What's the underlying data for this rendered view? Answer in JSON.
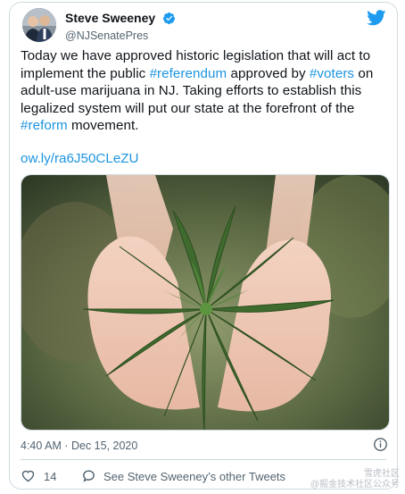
{
  "tweet": {
    "author": {
      "display_name": "Steve Sweeney",
      "handle": "@NJSenatePres",
      "verified": true
    },
    "text_parts": [
      {
        "type": "text",
        "value": "Today we have approved historic legislation that will act to implement the public "
      },
      {
        "type": "hashtag",
        "value": "#referendum"
      },
      {
        "type": "text",
        "value": " approved by "
      },
      {
        "type": "hashtag",
        "value": "#voters"
      },
      {
        "type": "text",
        "value": " on adult-use marijuana in NJ. Taking efforts to establish this legalized system will put our state at the forefront of the "
      },
      {
        "type": "hashtag",
        "value": "#reform"
      },
      {
        "type": "text",
        "value": " movement."
      }
    ],
    "link": "ow.ly/ra6J50CLeZU",
    "timestamp": "4:40 AM · Dec 15, 2020",
    "likes": "14",
    "see_more_label": "See Steve Sweeney’s other Tweets"
  },
  "watermark": {
    "line1": "雪虎社区",
    "line2": "@掘金技术社区公众号"
  },
  "colors": {
    "accent": "#1b95e0",
    "twitter_blue": "#1d9bf0",
    "text": "#0f1419",
    "secondary": "#536471",
    "border": "#cfd9de"
  },
  "icons": [
    "verified-badge-icon",
    "twitter-bird-icon",
    "info-icon",
    "heart-icon",
    "comment-icon"
  ]
}
